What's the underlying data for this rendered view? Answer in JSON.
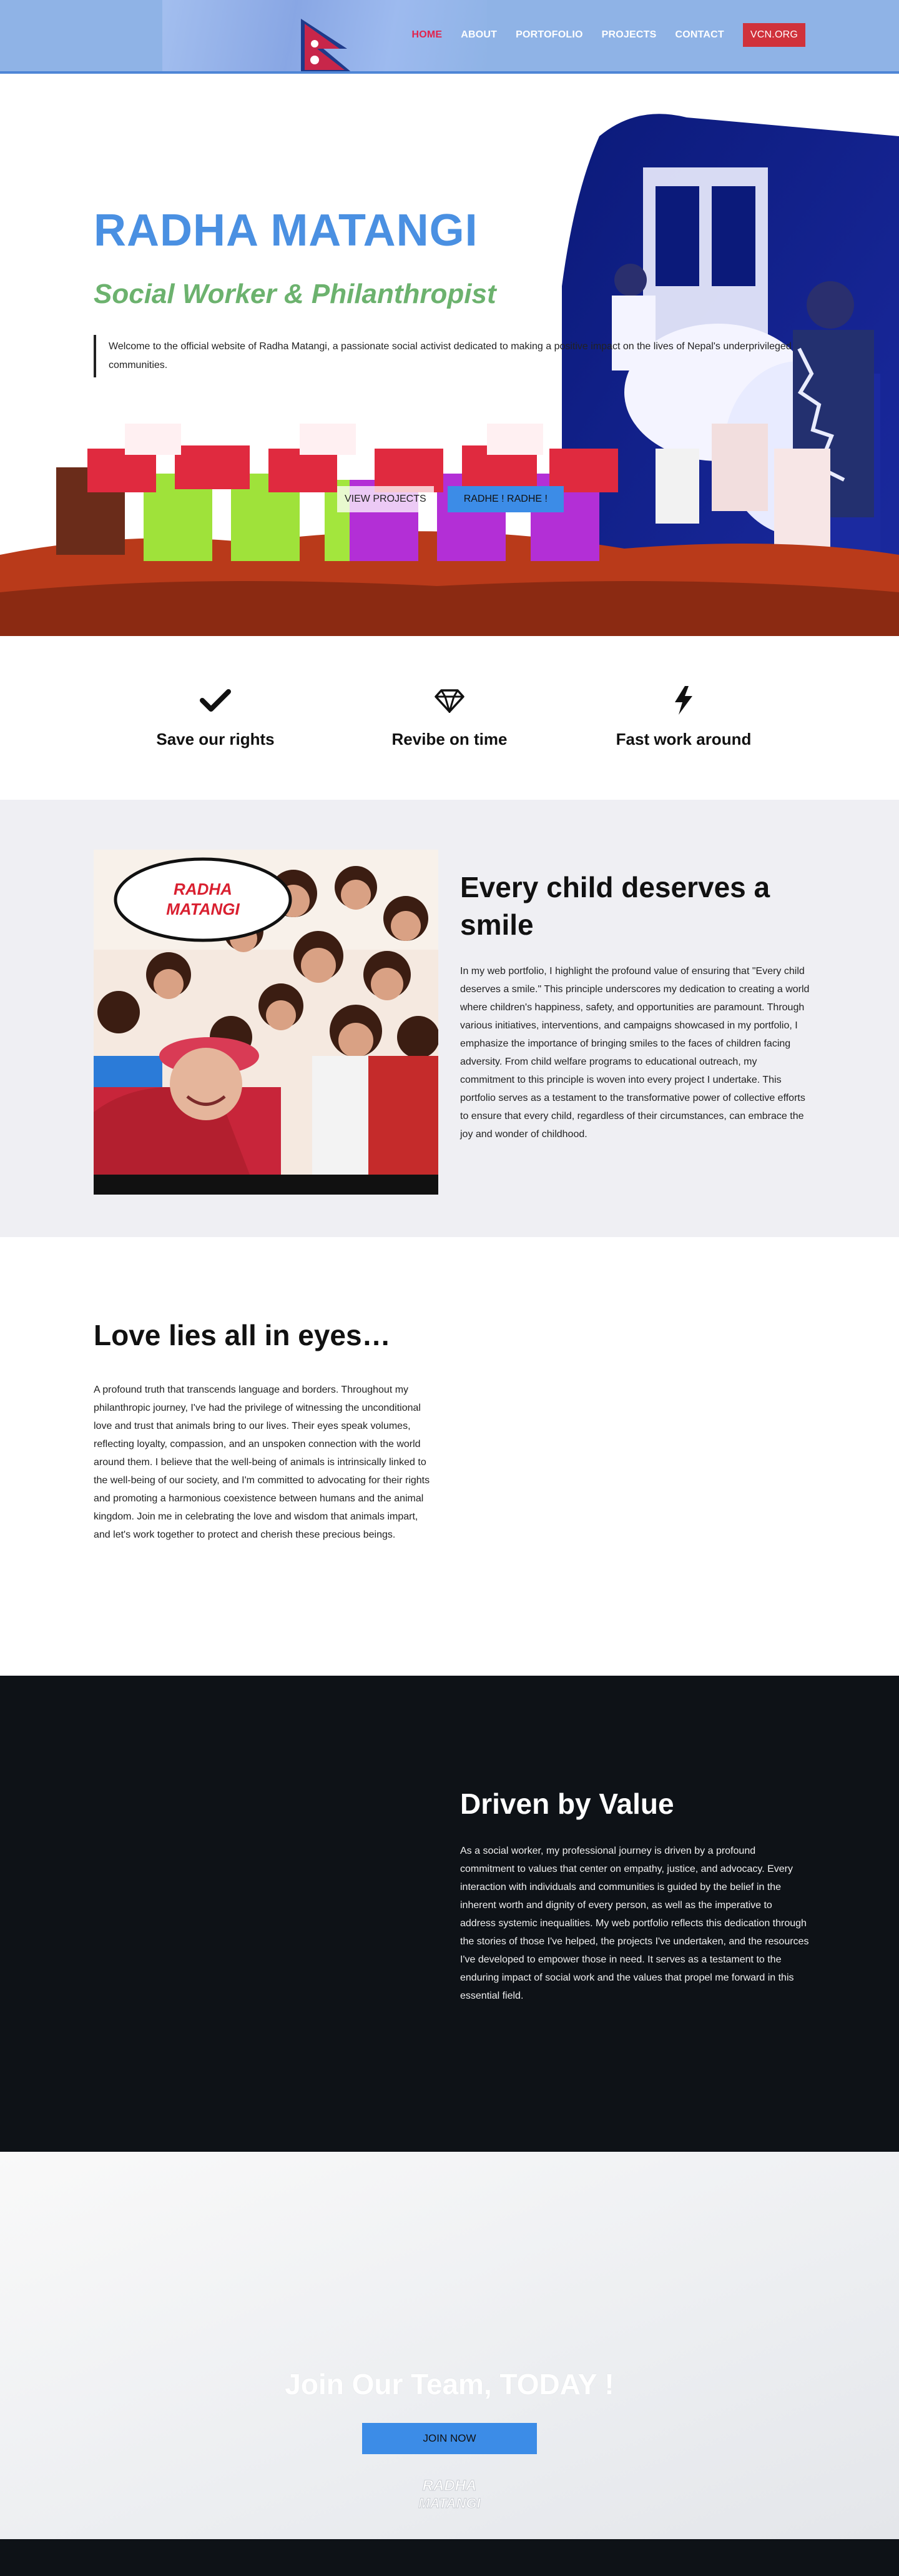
{
  "nav": {
    "items": [
      {
        "label": "HOME",
        "active": true
      },
      {
        "label": "ABOUT",
        "active": false
      },
      {
        "label": "PORTOFOLIO",
        "active": false
      },
      {
        "label": "PROJECTS",
        "active": false
      },
      {
        "label": "CONTACT",
        "active": false
      }
    ],
    "cta": "VCN.ORG"
  },
  "hero": {
    "title": "RADHA MATANGI",
    "subtitle": "Social Worker & Philanthropist",
    "intro": "Welcome to the official website of Radha Matangi, a passionate social activist dedicated to making a positive impact on the lives of Nepal's underprivileged communities.",
    "btn_projects": "VIEW PROJECTS",
    "btn_radhe": "RADHE ! RADHE !"
  },
  "features": [
    {
      "icon": "check-icon",
      "label": "Save our rights"
    },
    {
      "icon": "diamond-icon",
      "label": "Revibe on time"
    },
    {
      "icon": "bolt-icon",
      "label": "Fast work around"
    }
  ],
  "child": {
    "badge": "RADHA MATANGI",
    "title": "Every child deserves a smile",
    "body": "In my web portfolio, I highlight the profound value of ensuring that \"Every child deserves a smile.\" This principle underscores my dedication to creating a world where children's happiness, safety, and opportunities are paramount. Through various initiatives, interventions, and campaigns showcased in my portfolio, I emphasize the importance of bringing smiles to the faces of children facing adversity. From child welfare programs to educational outreach, my commitment to this principle is woven into every project I undertake. This portfolio serves as a testament to the transformative power of collective efforts to ensure that every child, regardless of their circumstances, can embrace the joy and wonder of childhood."
  },
  "love": {
    "title": "Love lies all in eyes…",
    "body": "A profound truth that transcends language and borders. Throughout my philanthropic journey, I've had the privilege of witnessing the unconditional love and trust that animals bring to our lives. Their eyes speak volumes, reflecting loyalty, compassion, and an unspoken connection with the world around them. I believe that the well-being of animals is intrinsically linked to the well-being of our society, and I'm committed to advocating for their rights and promoting a harmonious coexistence between humans and the animal kingdom. Join me in celebrating the love and wisdom that animals impart, and let's work together to protect and cherish these precious beings."
  },
  "driven": {
    "title": "Driven by Value",
    "body": "As a social worker, my professional journey is driven by a profound commitment to values that center on empathy, justice, and advocacy. Every interaction with individuals and communities is guided by the belief in the inherent worth and dignity of every person, as well as the imperative to address systemic inequalities. My web portfolio reflects this dedication through the stories of those I've helped, the projects I've undertaken, and the resources I've developed to empower those in need. It serves as a testament to the enduring impact of social work and the values that propel me forward in this essential field."
  },
  "join": {
    "title": "Join Our Team, TODAY !",
    "button": "JOIN NOW",
    "logo_text": "RADHA MATANGI"
  },
  "colors": {
    "header_bg": "#8fb3e6",
    "accent_blue": "#4a90e2",
    "button_blue": "#3c8ce7",
    "subtitle_green": "#6cb26e",
    "active_nav": "#e2234d",
    "cta_red": "#d0323b",
    "dark_bg": "#0e1217",
    "light_bg": "#efeff3"
  }
}
